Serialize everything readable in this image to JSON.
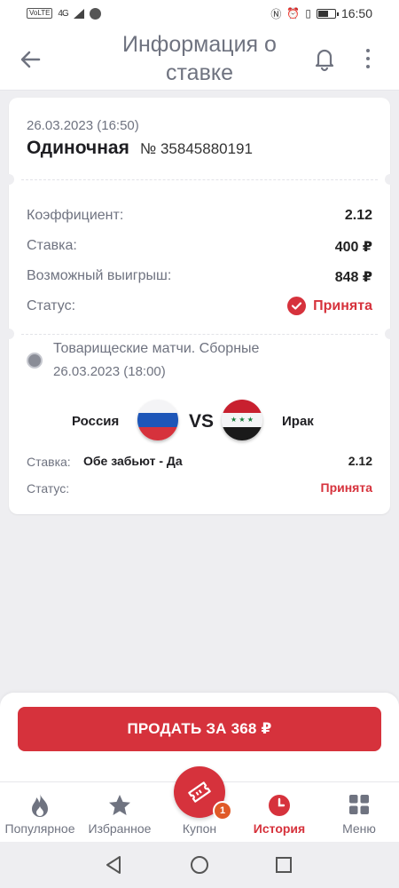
{
  "status_bar": {
    "volte": "VoLTE",
    "signal": "4G",
    "time": "16:50",
    "battery_level": 0.55
  },
  "header": {
    "title": "Информация о ставке"
  },
  "bet": {
    "date": "26.03.2023 (16:50)",
    "type": "Одиночная",
    "number": "№ 35845880191",
    "rows": {
      "coefficient_label": "Коэффициент:",
      "coefficient_value": "2.12",
      "stake_label": "Ставка:",
      "stake_value": "400 ₽",
      "payout_label": "Возможный выигрыш:",
      "payout_value": "848 ₽",
      "status_label": "Статус:",
      "status_value": "Принята"
    }
  },
  "event": {
    "league": "Товарищеские матчи. Сборные",
    "date": "26.03.2023 (18:00)",
    "home_team": "Россия",
    "vs": "VS",
    "away_team": "Ирак",
    "pick_label": "Ставка:",
    "pick_value": "Обе забьют - Да",
    "pick_odds": "2.12",
    "status_label": "Статус:",
    "status_value": "Принята"
  },
  "sell_button": {
    "label": "ПРОДАТЬ ЗА 368 ₽"
  },
  "bottom_nav": {
    "items": [
      {
        "label": "Популярное",
        "icon": "fire-icon"
      },
      {
        "label": "Избранное",
        "icon": "star-icon"
      },
      {
        "label": "Купон",
        "icon": "ticket-icon",
        "badge": "1"
      },
      {
        "label": "История",
        "icon": "clock-icon",
        "active": true
      },
      {
        "label": "Меню",
        "icon": "grid-icon"
      }
    ]
  },
  "colors": {
    "accent": "#d6323c",
    "background": "#eeeef1",
    "muted_text": "#6f7380"
  }
}
